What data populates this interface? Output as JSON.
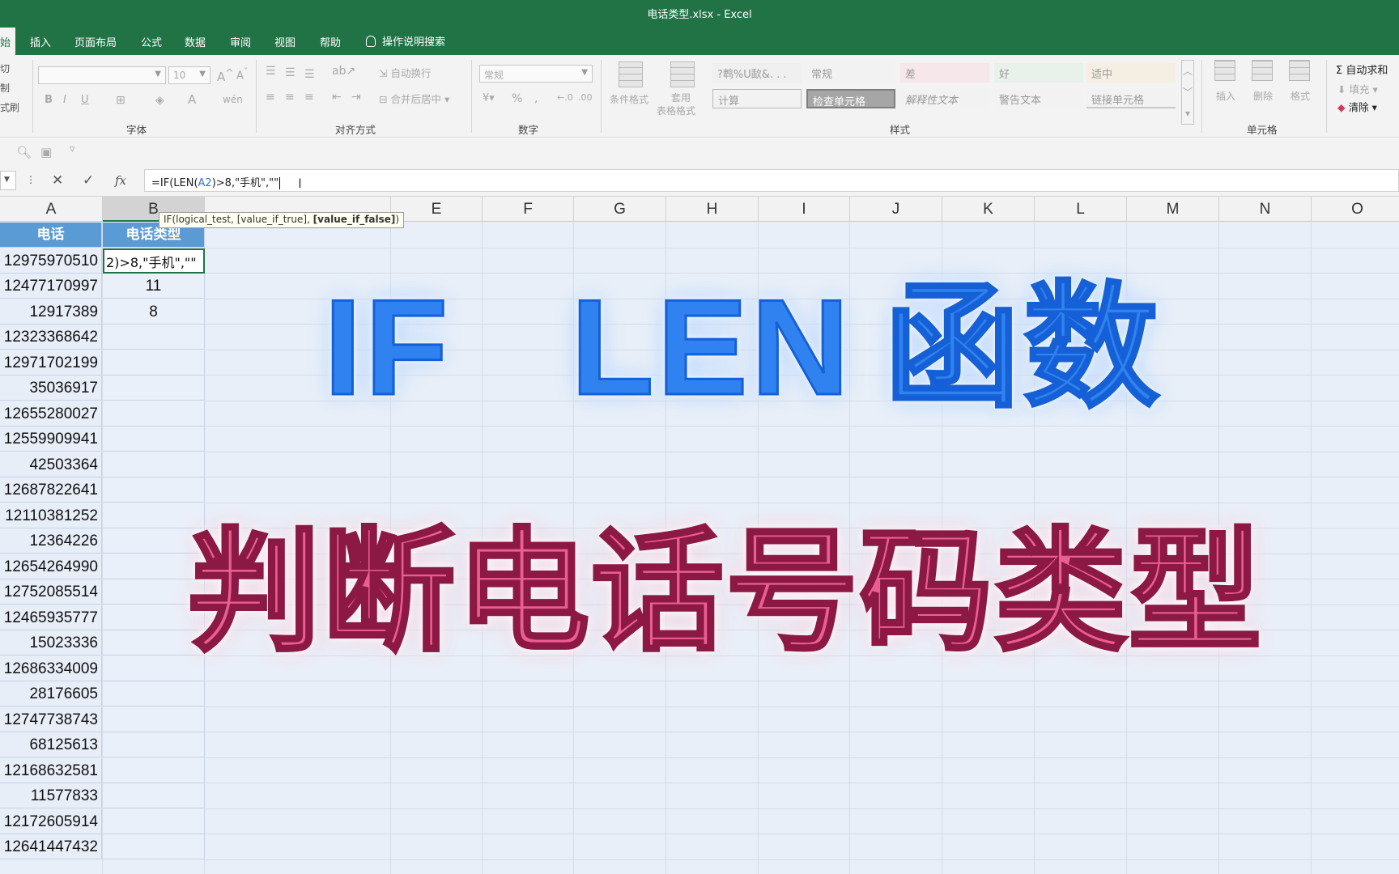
{
  "window": {
    "title": "电话类型.xlsx  -  Excel"
  },
  "tabs": {
    "active": "始",
    "items": [
      "插入",
      "页面布局",
      "公式",
      "数据",
      "审阅",
      "视图",
      "帮助"
    ],
    "search": "操作说明搜索"
  },
  "ribbon": {
    "clipboard": {
      "cut": "切",
      "copy": "制",
      "painter": "式刷"
    },
    "font_group": {
      "label": "字体",
      "size": "10"
    },
    "align_group": {
      "label": "对齐方式",
      "wrap": "自动换行",
      "merge": "合并后居中"
    },
    "number_group": {
      "label": "数字",
      "format": "常规"
    },
    "styles_group": {
      "label": "样式",
      "conditional": "条件格式",
      "table_format_1": "套用",
      "table_format_2": "表格格式",
      "cells": [
        {
          "text": "?鹎%U歃&. . .",
          "bg": "#f0f0f0"
        },
        {
          "text": "常规",
          "bg": "#f2f2f2"
        },
        {
          "text": "差",
          "bg": "#f5e7ea"
        },
        {
          "text": "好",
          "bg": "#e9f2ea"
        },
        {
          "text": "适中",
          "bg": "#f4efe2"
        },
        {
          "text": "计算",
          "bg": "#f2f2f2"
        },
        {
          "text": "检查单元格",
          "bg": "#a6a6a6"
        },
        {
          "text": "解释性文本",
          "bg": "#f2f2f2"
        },
        {
          "text": "警告文本",
          "bg": "#f2f2f2"
        },
        {
          "text": "链接单元格",
          "bg": "#f2f2f2"
        }
      ]
    },
    "cells_group": {
      "label": "单元格",
      "insert": "插入",
      "delete": "删除",
      "format": "格式"
    },
    "editing": {
      "autosum": "自动求和",
      "fill": "填充",
      "clear": "清除"
    }
  },
  "formula_bar": {
    "formula_prefix": "=IF(LEN(",
    "formula_ref": "A2",
    "formula_suffix": ")>8,\"手机\",\"\"",
    "tooltip_main": "IF(logical_test, [value_if_true], ",
    "tooltip_bold": "[value_if_false]",
    "tooltip_end": ")"
  },
  "sheet": {
    "columns": [
      "A",
      "B",
      "",
      "E",
      "F",
      "G",
      "H",
      "I",
      "J",
      "K",
      "L",
      "M",
      "N",
      "O"
    ],
    "header": {
      "a": "电话",
      "b": "电话类型"
    },
    "active_cell_text": "2)>8,\"手机\",\"\"",
    "rows": [
      {
        "a": "12975970510",
        "b": ""
      },
      {
        "a": "12477170997",
        "b": "11"
      },
      {
        "a": "12917389",
        "b": "8"
      },
      {
        "a": "12323368642",
        "b": ""
      },
      {
        "a": "12971702199",
        "b": ""
      },
      {
        "a": "35036917",
        "b": ""
      },
      {
        "a": "12655280027",
        "b": ""
      },
      {
        "a": "12559909941",
        "b": ""
      },
      {
        "a": "42503364",
        "b": ""
      },
      {
        "a": "12687822641",
        "b": ""
      },
      {
        "a": "12110381252",
        "b": ""
      },
      {
        "a": "12364226",
        "b": ""
      },
      {
        "a": "12654264990",
        "b": ""
      },
      {
        "a": "12752085514",
        "b": ""
      },
      {
        "a": "12465935777",
        "b": ""
      },
      {
        "a": "15023336",
        "b": ""
      },
      {
        "a": "12686334009",
        "b": ""
      },
      {
        "a": "28176605",
        "b": ""
      },
      {
        "a": "12747738743",
        "b": ""
      },
      {
        "a": "68125613",
        "b": ""
      },
      {
        "a": "12168632581",
        "b": ""
      },
      {
        "a": "11577833",
        "b": ""
      },
      {
        "a": "12172605914",
        "b": ""
      },
      {
        "a": "12641447432",
        "b": ""
      }
    ]
  },
  "overlay": {
    "line1_a": "IF",
    "line1_b": "LEN",
    "line1_c": "函数",
    "line2": "判断电话号码类型"
  }
}
